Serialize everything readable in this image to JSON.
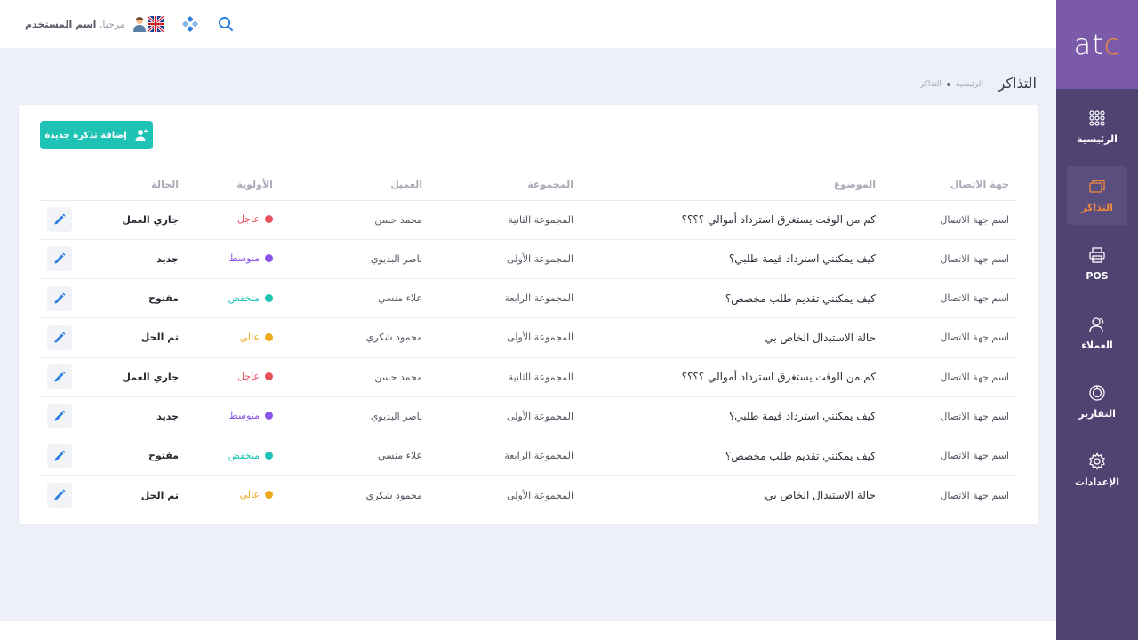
{
  "sidebar": {
    "logo": {
      "left": "at",
      "right": "c"
    },
    "items": [
      {
        "label": "الرئيسية",
        "icon": "grid-icon"
      },
      {
        "label": "التذاكر",
        "icon": "tickets-icon",
        "active": true
      },
      {
        "label": "POS",
        "icon": "printer-icon"
      },
      {
        "label": "العملاء",
        "icon": "customers-icon"
      },
      {
        "label": "التقارير",
        "icon": "reports-icon"
      },
      {
        "label": "الإعدادات",
        "icon": "gear-icon"
      }
    ]
  },
  "topbar": {
    "greeting_prefix": "مرحبا,",
    "username": "اسم المستخدم",
    "language_icon": "uk-flag-icon",
    "apps_icon": "apps-icon",
    "search_icon": "search-icon"
  },
  "page": {
    "title": "التذاكر",
    "breadcrumb": [
      "الرئيسية",
      "التذاكر"
    ]
  },
  "card": {
    "add_button_label": "إضافة تذكرة جديدة",
    "columns": [
      "جهة الاتصال",
      "الموضوع",
      "المجموعة",
      "العميل",
      "الأولوية",
      "الحالة"
    ],
    "rows": [
      {
        "contact": "اسم جهة الاتصال",
        "subject": "كم من الوقت يستغرق استرداد أموالي ؟؟؟؟",
        "group": "المجموعة الثانية",
        "customer": "محمد حسن",
        "priority": "عاجل",
        "status": "جاري العمل"
      },
      {
        "contact": "اسم جهة الاتصال",
        "subject": "كيف يمكنني استرداد قيمة طلبي؟",
        "group": "المجموعة الأولى",
        "customer": "ناصر البديوي",
        "priority": "متوسط",
        "status": "جديد"
      },
      {
        "contact": "اسم جهة الاتصال",
        "subject": "كيف يمكنني تقديم طلب مخصص؟",
        "group": "المجموعة الرابعة",
        "customer": "علاء منسي",
        "priority": "منخفض",
        "status": "مفتوح"
      },
      {
        "contact": "اسم جهة الاتصال",
        "subject": "حالة الاستبدال الخاص بي",
        "group": "المجموعة الأولى",
        "customer": "محمود شكري",
        "priority": "عالي",
        "status": "تم الحل"
      },
      {
        "contact": "اسم جهة الاتصال",
        "subject": "كم من الوقت يستغرق استرداد أموالي ؟؟؟؟",
        "group": "المجموعة الثانية",
        "customer": "محمد حسن",
        "priority": "عاجل",
        "status": "جاري العمل"
      },
      {
        "contact": "اسم جهة الاتصال",
        "subject": "كيف يمكنني استرداد قيمة طلبي؟",
        "group": "المجموعة الأولى",
        "customer": "ناصر البديوي",
        "priority": "متوسط",
        "status": "جديد"
      },
      {
        "contact": "اسم جهة الاتصال",
        "subject": "كيف يمكنني تقديم طلب مخصص؟",
        "group": "المجموعة الرابعة",
        "customer": "علاء منسي",
        "priority": "منخفض",
        "status": "مفتوح"
      },
      {
        "contact": "اسم جهة الاتصال",
        "subject": "حالة الاستبدال الخاص بي",
        "group": "المجموعة الأولى",
        "customer": "محمود شكري",
        "priority": "عالي",
        "status": "تم الحل"
      }
    ]
  },
  "colors": {
    "sidebar_bg": "#4f4372",
    "logo_bg": "#7b5ba9",
    "accent_orange": "#f08a3c",
    "button_teal": "#1ec3b5",
    "edit_blue": "#2b7fe0",
    "priority": {
      "عاجل": "#e8505b",
      "متوسط": "#8b54e8",
      "منخفض": "#1ec3b5",
      "عالي": "#f0a81c"
    }
  }
}
